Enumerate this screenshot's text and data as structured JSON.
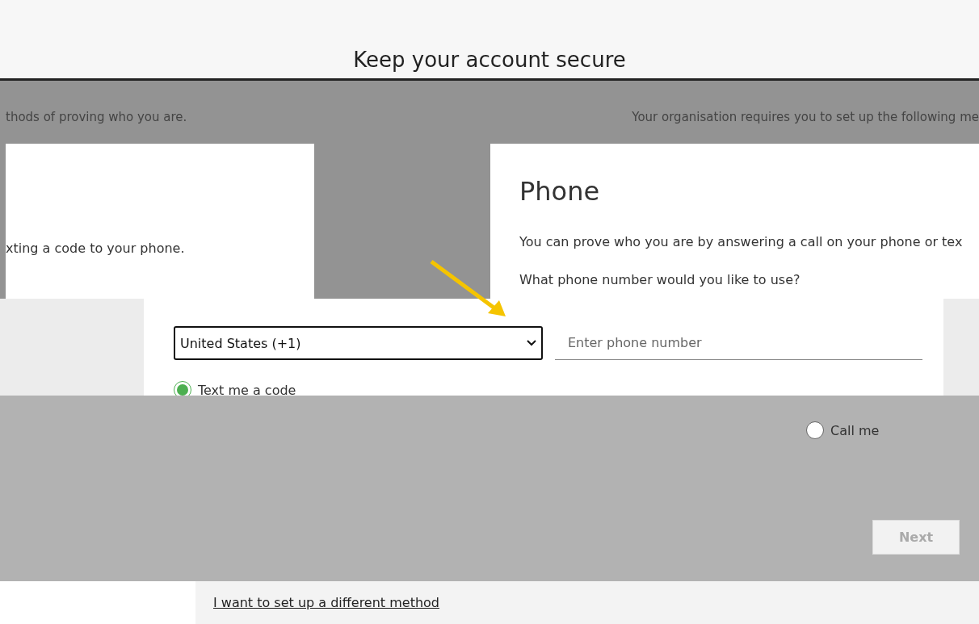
{
  "header": {
    "title": "Keep your account secure"
  },
  "intro": {
    "left": "thods of proving who you are.",
    "right": "Your organisation requires you to set up the following me"
  },
  "left_card": {
    "text": "xting a code to your phone."
  },
  "phone_card": {
    "title": "Phone",
    "description": "You can prove who you are by answering a call on your phone or tex",
    "question": "What phone number would you like to use?"
  },
  "country_select": {
    "value": "United States (+1)"
  },
  "phone_input": {
    "placeholder": "Enter phone number"
  },
  "options": [
    {
      "label": "Text me a code",
      "selected": true
    },
    {
      "label": "Call me",
      "selected": false
    }
  ],
  "next_button": {
    "label": "Next",
    "disabled": true
  },
  "footer_link": "I want to set up a different method"
}
